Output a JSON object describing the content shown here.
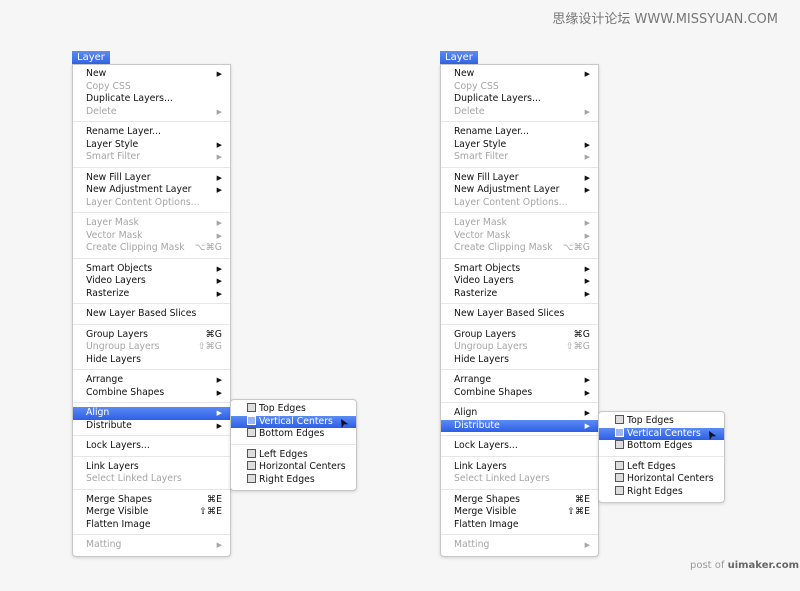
{
  "watermark_top": "思缘设计论坛 WWW.MISSYUAN.COM",
  "watermark_bottom": {
    "prefix": "post of ",
    "site": "uimaker.com"
  },
  "menu_title": "Layer",
  "groups": [
    [
      {
        "label": "New",
        "sub": true
      },
      {
        "label": "Copy CSS",
        "disabled": true
      },
      {
        "label": "Duplicate Layers..."
      },
      {
        "label": "Delete",
        "disabled": true,
        "sub": true
      }
    ],
    [
      {
        "label": "Rename Layer..."
      },
      {
        "label": "Layer Style",
        "sub": true
      },
      {
        "label": "Smart Filter",
        "disabled": true,
        "sub": true
      }
    ],
    [
      {
        "label": "New Fill Layer",
        "sub": true
      },
      {
        "label": "New Adjustment Layer",
        "sub": true
      },
      {
        "label": "Layer Content Options...",
        "disabled": true
      }
    ],
    [
      {
        "label": "Layer Mask",
        "disabled": true,
        "sub": true
      },
      {
        "label": "Vector Mask",
        "disabled": true,
        "sub": true
      },
      {
        "label": "Create Clipping Mask",
        "disabled": true,
        "shortcut": "⌥⌘G"
      }
    ],
    [
      {
        "label": "Smart Objects",
        "sub": true
      },
      {
        "label": "Video Layers",
        "sub": true
      },
      {
        "label": "Rasterize",
        "sub": true
      }
    ],
    [
      {
        "label": "New Layer Based Slices"
      }
    ],
    [
      {
        "label": "Group Layers",
        "shortcut": "⌘G"
      },
      {
        "label": "Ungroup Layers",
        "disabled": true,
        "shortcut": "⇧⌘G"
      },
      {
        "label": "Hide Layers"
      }
    ],
    [
      {
        "label": "Arrange",
        "sub": true
      },
      {
        "label": "Combine Shapes",
        "sub": true
      }
    ],
    [
      {
        "label": "Align",
        "sub": true
      },
      {
        "label": "Distribute",
        "sub": true
      }
    ],
    [
      {
        "label": "Lock Layers..."
      }
    ],
    [
      {
        "label": "Link Layers"
      },
      {
        "label": "Select Linked Layers",
        "disabled": true
      }
    ],
    [
      {
        "label": "Merge Shapes",
        "shortcut": "⌘E"
      },
      {
        "label": "Merge Visible",
        "shortcut": "⇧⌘E"
      },
      {
        "label": "Flatten Image"
      }
    ],
    [
      {
        "label": "Matting",
        "disabled": true,
        "sub": true
      }
    ]
  ],
  "menus": [
    {
      "highlighted": "Align",
      "submenu": {
        "groups": [
          [
            {
              "label": "Top Edges",
              "icon": "align-top-edges-icon"
            },
            {
              "label": "Vertical Centers",
              "icon": "align-vertical-centers-icon",
              "highlighted": true
            },
            {
              "label": "Bottom Edges",
              "icon": "align-bottom-edges-icon"
            }
          ],
          [
            {
              "label": "Left Edges",
              "icon": "align-left-edges-icon"
            },
            {
              "label": "Horizontal Centers",
              "icon": "align-horizontal-centers-icon"
            },
            {
              "label": "Right Edges",
              "icon": "align-right-edges-icon"
            }
          ]
        ]
      }
    },
    {
      "highlighted": "Distribute",
      "submenu": {
        "groups": [
          [
            {
              "label": "Top Edges",
              "icon": "distribute-top-edges-icon"
            },
            {
              "label": "Vertical Centers",
              "icon": "distribute-vertical-centers-icon",
              "highlighted": true
            },
            {
              "label": "Bottom Edges",
              "icon": "distribute-bottom-edges-icon"
            }
          ],
          [
            {
              "label": "Left Edges",
              "icon": "distribute-left-edges-icon"
            },
            {
              "label": "Horizontal Centers",
              "icon": "distribute-horizontal-centers-icon"
            },
            {
              "label": "Right Edges",
              "icon": "distribute-right-edges-icon"
            }
          ]
        ]
      }
    }
  ]
}
